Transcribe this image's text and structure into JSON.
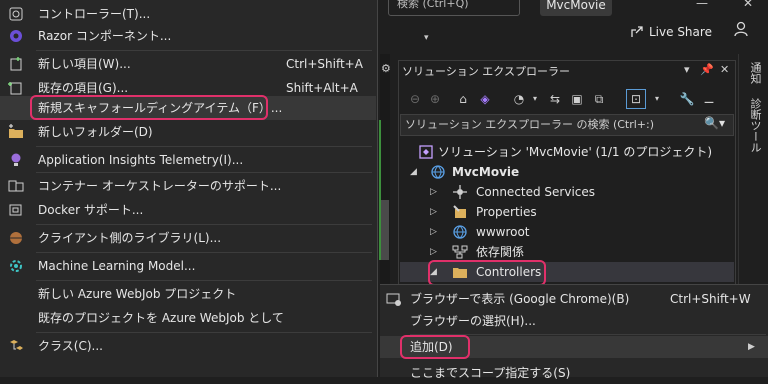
{
  "top": {
    "search_text": "検索 (Ctrl+Q)",
    "project_name": "MvcMovie",
    "share_label": "Live Share",
    "minimize": "—",
    "close": "✕"
  },
  "right_strip": {
    "tab_notifications": "通知",
    "tab_diagnostics": "診断ツール"
  },
  "solution_explorer": {
    "title": "ソリューション エクスプローラー",
    "search_placeholder": "ソリューション エクスプローラー の検索 (Ctrl+:)",
    "solution_label": "ソリューション 'MvcMovie' (1/1 のプロジェクト)",
    "project_label": "MvcMovie",
    "nodes": [
      {
        "label": "Connected Services"
      },
      {
        "label": "Properties"
      },
      {
        "label": "wwwroot"
      },
      {
        "label": "依存関係"
      },
      {
        "label": "Controllers"
      }
    ]
  },
  "left_menu": {
    "items": [
      {
        "label": "コントローラー(T)..."
      },
      {
        "label": "Razor コンポーネント..."
      },
      {
        "label": "新しい項目(W)...",
        "shortcut": "Ctrl+Shift+A"
      },
      {
        "label": "既存の項目(G)...",
        "shortcut": "Shift+Alt+A"
      },
      {
        "label": "新規スキャフォールディングアイテム（F）..."
      },
      {
        "label": "新しいフォルダー(D)"
      },
      {
        "label": "Application Insights Telemetry(I)..."
      },
      {
        "label": "コンテナー オーケストレーターのサポート..."
      },
      {
        "label": "Docker サポート..."
      },
      {
        "label": "クライアント側のライブラリ(L)..."
      },
      {
        "label": "Machine Learning Model..."
      },
      {
        "label": "新しい Azure WebJob プロジェクト"
      },
      {
        "label": "既存のプロジェクトを Azure WebJob として"
      },
      {
        "label": "クラス(C)..."
      }
    ]
  },
  "right_menu": {
    "items": [
      {
        "label": "ブラウザーで表示 (Google Chrome)(B)",
        "shortcut": "Ctrl+Shift+W"
      },
      {
        "label": "ブラウザーの選択(H)..."
      },
      {
        "label": "追加(D)"
      },
      {
        "label": "ここまでスコープ指定する(S)"
      }
    ]
  },
  "colors": {
    "accent_pink": "#e0306a",
    "menu_bg": "#282828",
    "folder": "#dcb05c",
    "vs_purple": "#8a5cd6"
  }
}
